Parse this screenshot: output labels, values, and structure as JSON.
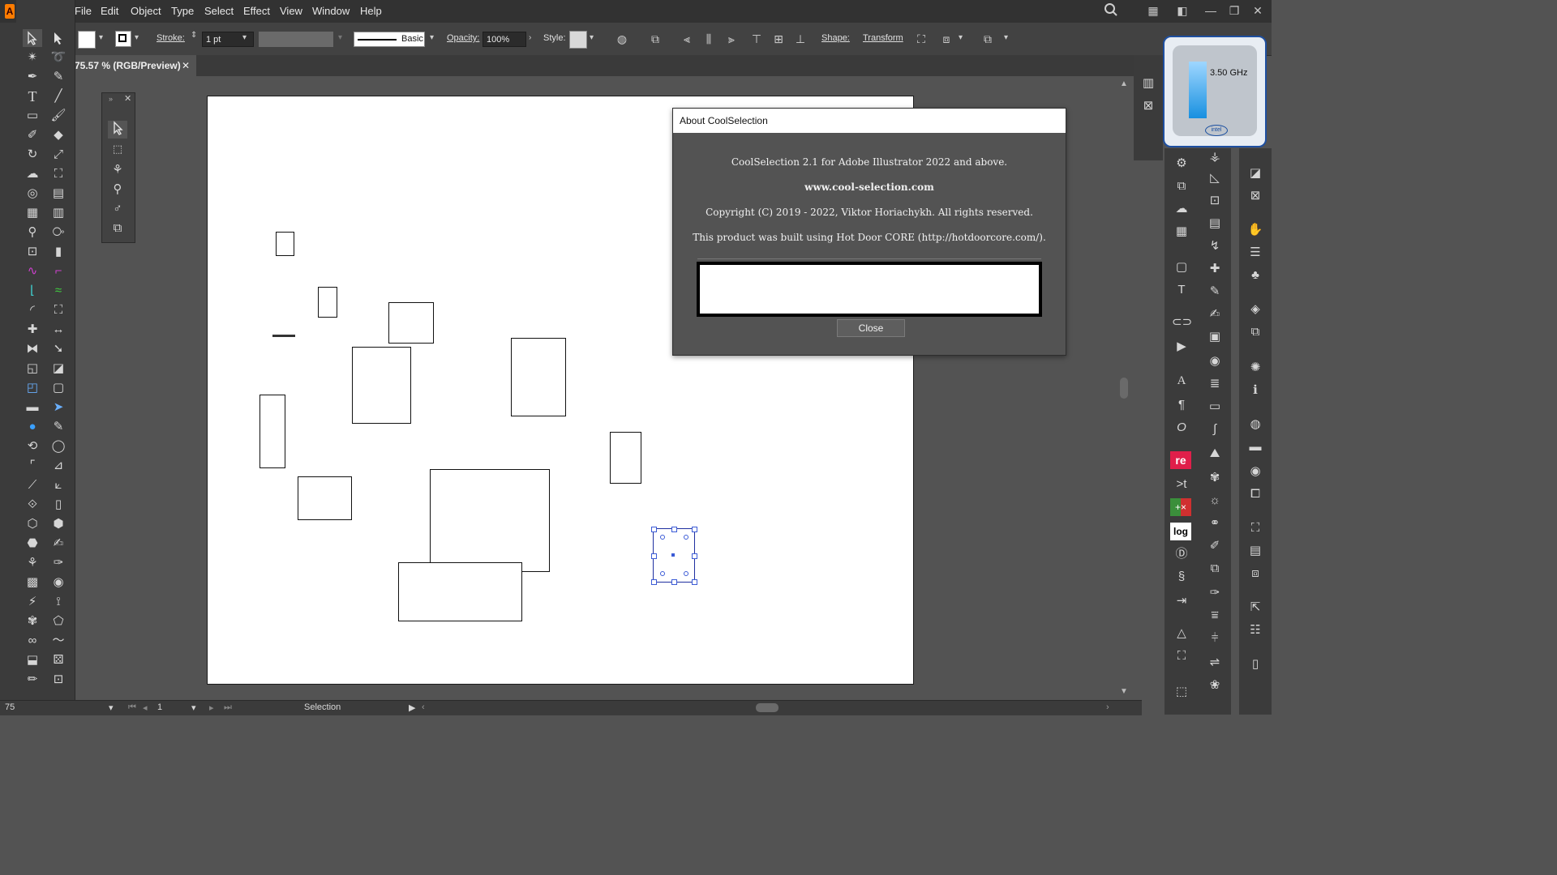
{
  "app": {
    "logo": "A"
  },
  "menu": [
    "File",
    "Edit",
    "Object",
    "Type",
    "Select",
    "Effect",
    "View",
    "Window",
    "Help"
  ],
  "control_bar": {
    "stroke_label": "Stroke:",
    "stroke_value": "1 pt",
    "brush_value": "Basic",
    "opacity_label": "Opacity:",
    "opacity_value": "100%",
    "style_label": "Style:",
    "shape_label": "Shape:",
    "transform_label": "Transform"
  },
  "document_tab": {
    "title": "75.57 % (RGB/Preview)",
    "close": "✕"
  },
  "dialog": {
    "title": "About CoolSelection",
    "line1": "CoolSelection 2.1 for Adobe Illustrator 2022 and above.",
    "line2": "www.cool-selection.com",
    "line3": "Copyright (C) 2019 - 2022, Viktor Horiachykh. All rights reserved.",
    "line4": "This product was built using Hot Door CORE (http://hotdoorcore.com/).",
    "close_label": "Close"
  },
  "cpu_widget": {
    "frequency": "3.50 GHz",
    "brand": "intel"
  },
  "status_bar": {
    "zoom": "75",
    "page": "1",
    "tool": "Selection"
  },
  "right_panel": {
    "badge_re": "re",
    "badge_log": "log"
  },
  "colors": {
    "accent": "#1f5fd6",
    "selection": "#3b5bd6"
  }
}
